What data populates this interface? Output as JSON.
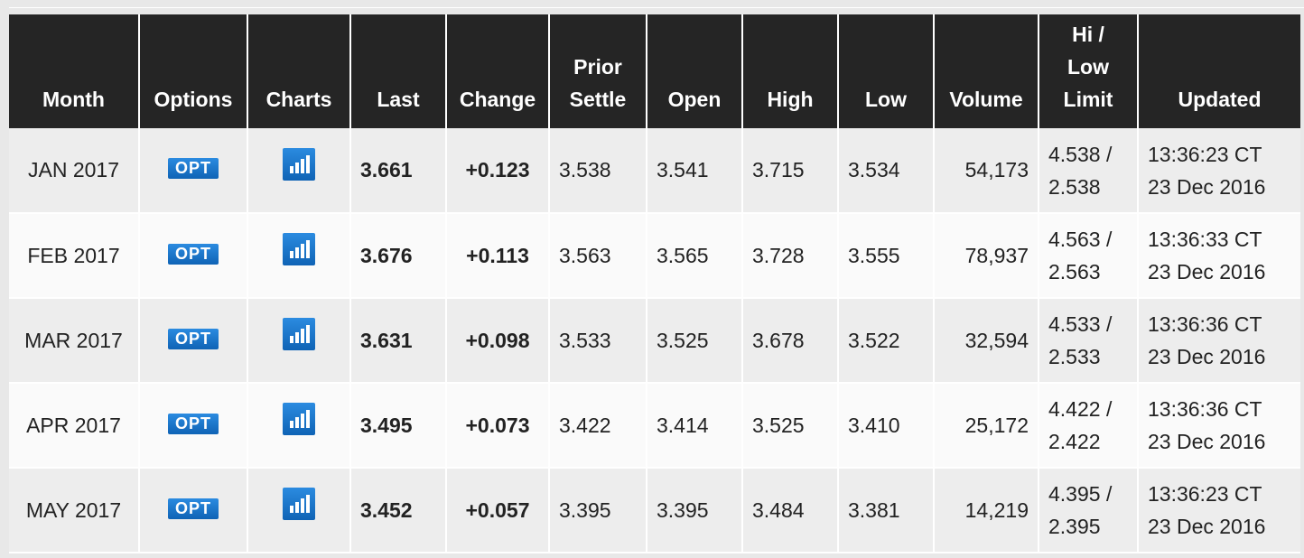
{
  "columns": [
    "Month",
    "Options",
    "Charts",
    "Last",
    "Change",
    "Prior Settle",
    "Open",
    "High",
    "Low",
    "Volume",
    "Hi / Low Limit",
    "Updated"
  ],
  "header_lines": {
    "month": [
      "Month"
    ],
    "options": [
      "Options"
    ],
    "charts": [
      "Charts"
    ],
    "last": [
      "Last"
    ],
    "change": [
      "Change"
    ],
    "prior_settle": [
      "Prior",
      "Settle"
    ],
    "open": [
      "Open"
    ],
    "high": [
      "High"
    ],
    "low": [
      "Low"
    ],
    "volume": [
      "Volume"
    ],
    "limit": [
      "Hi /",
      "Low",
      "Limit"
    ],
    "updated": [
      "Updated"
    ]
  },
  "rows": [
    {
      "month": "JAN 2017",
      "options_label": "OPT",
      "chart_icon": "bar-chart-icon",
      "last": "3.661",
      "change": "+0.123",
      "prior_settle": "3.538",
      "open": "3.541",
      "high": "3.715",
      "low": "3.534",
      "volume": "54,173",
      "limit_hi": "4.538 /",
      "limit_low": "2.538",
      "updated_time": "13:36:23 CT",
      "updated_date": "23 Dec 2016"
    },
    {
      "month": "FEB 2017",
      "options_label": "OPT",
      "chart_icon": "bar-chart-icon",
      "last": "3.676",
      "change": "+0.113",
      "prior_settle": "3.563",
      "open": "3.565",
      "high": "3.728",
      "low": "3.555",
      "volume": "78,937",
      "limit_hi": "4.563 /",
      "limit_low": "2.563",
      "updated_time": "13:36:33 CT",
      "updated_date": "23 Dec 2016"
    },
    {
      "month": "MAR 2017",
      "options_label": "OPT",
      "chart_icon": "bar-chart-icon",
      "last": "3.631",
      "change": "+0.098",
      "prior_settle": "3.533",
      "open": "3.525",
      "high": "3.678",
      "low": "3.522",
      "volume": "32,594",
      "limit_hi": "4.533 /",
      "limit_low": "2.533",
      "updated_time": "13:36:36 CT",
      "updated_date": "23 Dec 2016"
    },
    {
      "month": "APR 2017",
      "options_label": "OPT",
      "chart_icon": "bar-chart-icon",
      "last": "3.495",
      "change": "+0.073",
      "prior_settle": "3.422",
      "open": "3.414",
      "high": "3.525",
      "low": "3.410",
      "volume": "25,172",
      "limit_hi": "4.422 /",
      "limit_low": "2.422",
      "updated_time": "13:36:36 CT",
      "updated_date": "23 Dec 2016"
    },
    {
      "month": "MAY 2017",
      "options_label": "OPT",
      "chart_icon": "bar-chart-icon",
      "last": "3.452",
      "change": "+0.057",
      "prior_settle": "3.395",
      "open": "3.395",
      "high": "3.484",
      "low": "3.381",
      "volume": "14,219",
      "limit_hi": "4.395 /",
      "limit_low": "2.395",
      "updated_time": "13:36:23 CT",
      "updated_date": "23 Dec 2016"
    }
  ],
  "colors": {
    "header_bg": "#252525",
    "positive_change": "#2a9d2a",
    "button_blue": "#1a74c8",
    "row_odd": "#ededed",
    "row_even": "#fafafa"
  }
}
